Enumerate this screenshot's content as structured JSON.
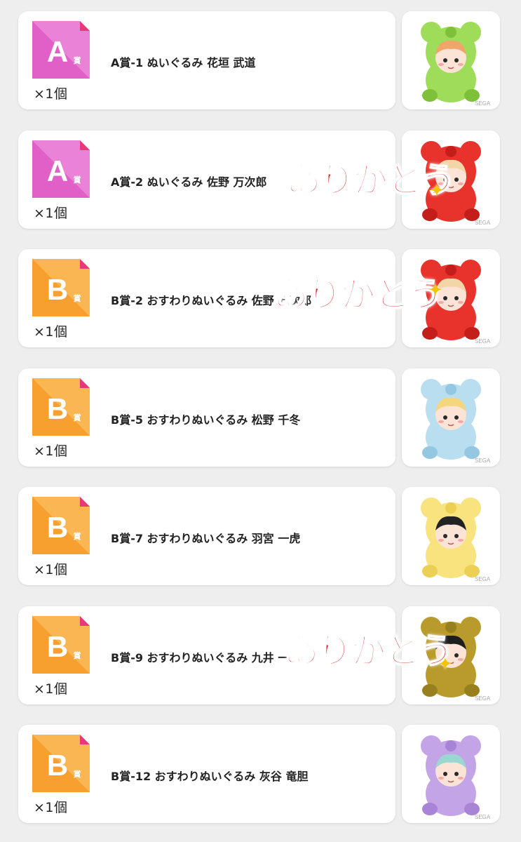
{
  "items": [
    {
      "tier": "A",
      "tier_suffix": "賞",
      "qty": "×1個",
      "name": "A賞-1 ぬいぐるみ 花垣 武道",
      "plush_color": "#9fdc5a",
      "plush_dark": "#7fc03a",
      "hair": "#f0a66a",
      "stamp": null
    },
    {
      "tier": "A",
      "tier_suffix": "賞",
      "qty": "×1個",
      "name": "A賞-2 ぬいぐるみ 佐野 万次郎",
      "plush_color": "#e8332d",
      "plush_dark": "#c41e1a",
      "hair": "#f2d6a8",
      "stamp": "ありがとう"
    },
    {
      "tier": "B",
      "tier_suffix": "賞",
      "qty": "×1個",
      "name": "B賞-2 おすわりぬいぐるみ 佐野 万次郎",
      "plush_color": "#e8332d",
      "plush_dark": "#c41e1a",
      "hair": "#f2d6a8",
      "stamp": "ありがとう"
    },
    {
      "tier": "B",
      "tier_suffix": "賞",
      "qty": "×1個",
      "name": "B賞-5 おすわりぬいぐるみ 松野 千冬",
      "plush_color": "#b9def0",
      "plush_dark": "#93c7e2",
      "hair": "#f4d77c",
      "stamp": null
    },
    {
      "tier": "B",
      "tier_suffix": "賞",
      "qty": "×1個",
      "name": "B賞-7 おすわりぬいぐるみ 羽宮 一虎",
      "plush_color": "#f9e37e",
      "plush_dark": "#ecd055",
      "hair": "#222222",
      "stamp": null
    },
    {
      "tier": "B",
      "tier_suffix": "賞",
      "qty": "×1個",
      "name": "B賞-9 おすわりぬいぐるみ 九井 一",
      "plush_color": "#b99a2c",
      "plush_dark": "#98801e",
      "hair": "#1e1e1e",
      "stamp": "ありがとう"
    },
    {
      "tier": "B",
      "tier_suffix": "賞",
      "qty": "×1個",
      "name": "B賞-12 おすわりぬいぐるみ 灰谷 竜胆",
      "plush_color": "#c3a4e6",
      "plush_dark": "#a884d6",
      "hair": "#9cd6d0",
      "stamp": null
    }
  ],
  "tier_colors": {
    "A": "#e060c8",
    "A_light": "#f09ae2",
    "B": "#f7a030",
    "B_light": "#fcc46a",
    "corner": "#e6397a"
  },
  "watermark": "SEGA",
  "sparkle_glyph": "✦"
}
